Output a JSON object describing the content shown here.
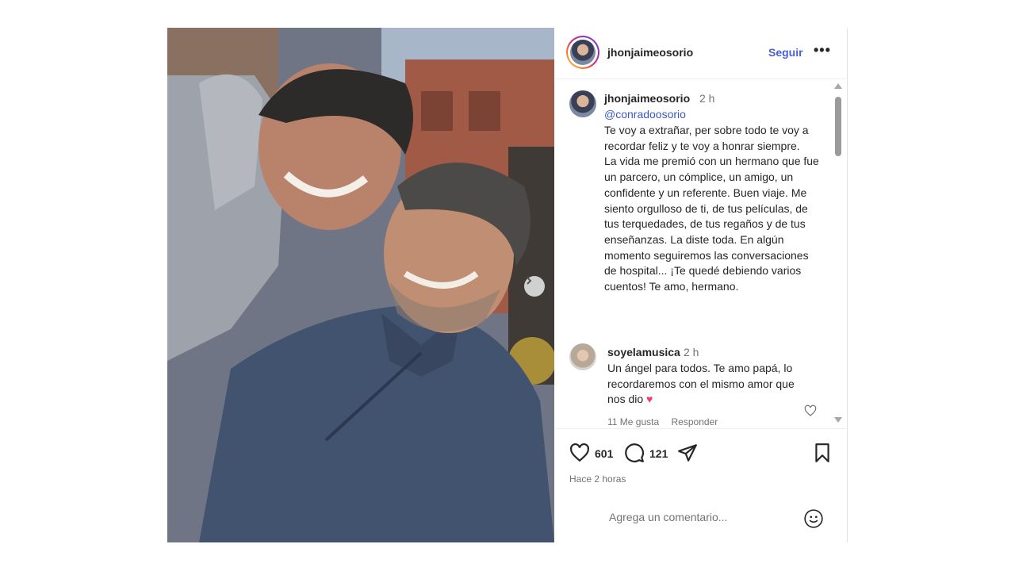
{
  "post": {
    "username": "jhonjaimeosorio",
    "follow_label": "Seguir",
    "more_label": "•••"
  },
  "caption": {
    "username": "jhonjaimeosorio",
    "time": "2 h",
    "mention": "@conradoosorio",
    "text": "Te voy a extrañar, per sobre todo te voy a recordar feliz y te voy a honrar siempre.\nLa vida me premió con un hermano que fue un parcero, un cómplice, un amigo, un confidente y un referente. Buen viaje. Me siento orgulloso de ti, de tus películas, de tus terquedades, de tus regaños y de tus enseñanzas. La diste toda. En algún momento seguiremos las conversaciones de hospital... ¡Te quedé debiendo varios cuentos! Te amo, hermano."
  },
  "reply": {
    "username": "soyelamusica",
    "time": "2 h",
    "text": "Un ángel para todos. Te amo papá, lo recordaremos con el mismo amor que nos dio",
    "emoji": "♥",
    "likes_label": "11 Me gusta",
    "reply_label": "Responder"
  },
  "stats": {
    "likes": "601",
    "comments": "121",
    "time_ago": "Hace 2 horas"
  },
  "add_comment": {
    "placeholder": "Agrega un comentario..."
  },
  "icons": {
    "next": "chevron-right-icon",
    "like": "heart-icon",
    "comment": "comment-icon",
    "share": "send-icon",
    "save": "bookmark-icon",
    "emoji": "smiley-icon"
  },
  "colors": {
    "link": "#4a5ed8",
    "mention": "#3a58c6",
    "heart": "#ec407a"
  }
}
